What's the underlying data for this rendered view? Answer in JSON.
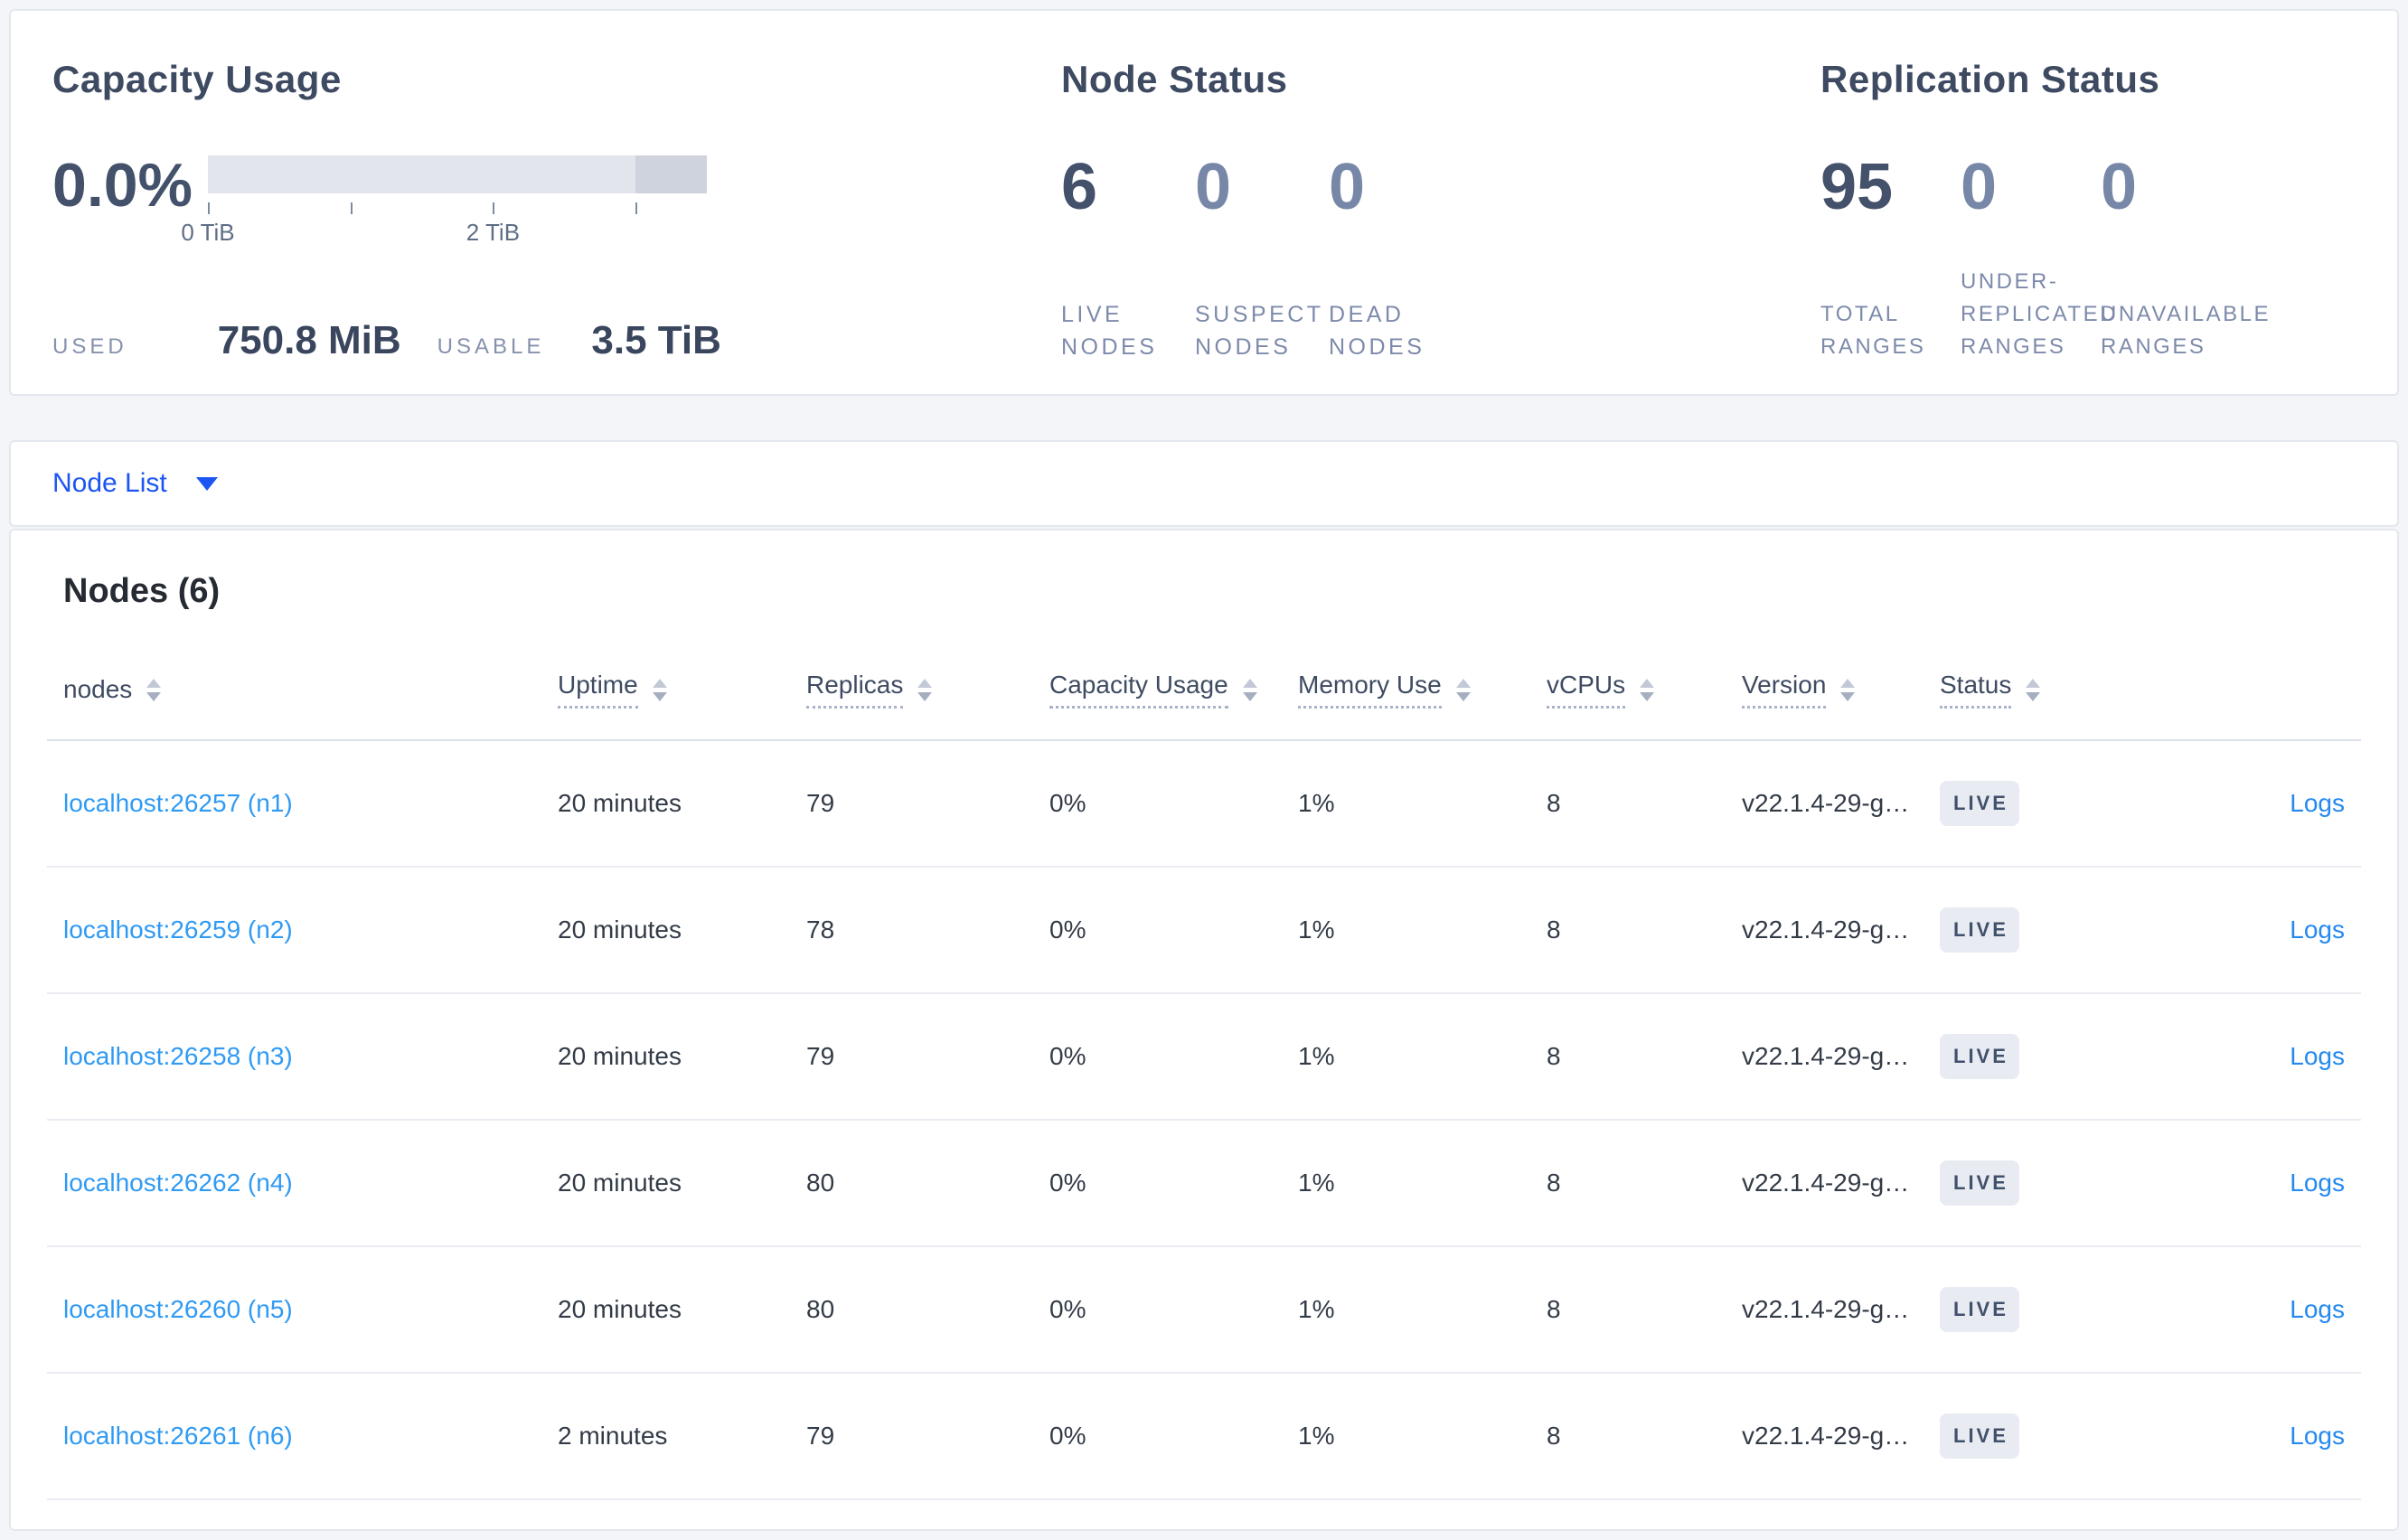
{
  "colors": {
    "accent_blue": "#1c55f2",
    "node_link_blue": "#2f9af3",
    "logs_link_blue": "#2489f0",
    "live_badge_bg": "#e8ebf2",
    "live_badge_text": "#41506b",
    "bar_light": "#e2e5eb",
    "bar_dark": "#ced3dd",
    "stat_primary": "#44516a",
    "stat_muted": "#7787a8"
  },
  "icons": {
    "chevron_down": "triangle-down",
    "sort": "double-triangle-up-down"
  },
  "summary": {
    "capacity": {
      "title": "Capacity Usage",
      "percent": "0.0%",
      "used_label": "USED",
      "used_value": "750.8 MiB",
      "usable_label": "USABLE",
      "usable_value": "3.5 TiB",
      "axis": {
        "max_tib": 3.5,
        "dark_from_percent": 85.7,
        "ticks": [
          {
            "pos": 0,
            "label": "0 TiB"
          },
          {
            "pos": 28.57,
            "label": ""
          },
          {
            "pos": 57.14,
            "label": "2 TiB"
          },
          {
            "pos": 85.71,
            "label": ""
          }
        ]
      }
    },
    "node_status": {
      "title": "Node Status",
      "stats": [
        {
          "value": "6",
          "label": "LIVE NODES",
          "muted": false
        },
        {
          "value": "0",
          "label": "SUSPECT NODES",
          "muted": true
        },
        {
          "value": "0",
          "label": "DEAD NODES",
          "muted": true
        }
      ]
    },
    "replication": {
      "title": "Replication Status",
      "stats": [
        {
          "value": "95",
          "label": "TOTAL RANGES",
          "muted": false
        },
        {
          "value": "0",
          "label": "UNDER-REPLICATED RANGES",
          "muted": true
        },
        {
          "value": "0",
          "label": "UNAVAILABLE RANGES",
          "muted": true
        }
      ]
    }
  },
  "view_selector": {
    "label": "Node List"
  },
  "table": {
    "title": "Nodes (6)",
    "columns": [
      {
        "label": "nodes",
        "sortable": true,
        "underline": false
      },
      {
        "label": "Uptime",
        "sortable": true,
        "underline": true
      },
      {
        "label": "Replicas",
        "sortable": true,
        "underline": true
      },
      {
        "label": "Capacity Usage",
        "sortable": true,
        "underline": true
      },
      {
        "label": "Memory Use",
        "sortable": true,
        "underline": true
      },
      {
        "label": "vCPUs",
        "sortable": true,
        "underline": true
      },
      {
        "label": "Version",
        "sortable": true,
        "underline": true
      },
      {
        "label": "Status",
        "sortable": true,
        "underline": true
      },
      {
        "label": "",
        "sortable": false,
        "underline": false
      }
    ],
    "rows": [
      {
        "node": "localhost:26257 (n1)",
        "uptime": "20 minutes",
        "replicas": "79",
        "capacity": "0%",
        "memory": "1%",
        "vcpus": "8",
        "version": "v22.1.4-29-g…",
        "status": "LIVE",
        "logs": "Logs"
      },
      {
        "node": "localhost:26259 (n2)",
        "uptime": "20 minutes",
        "replicas": "78",
        "capacity": "0%",
        "memory": "1%",
        "vcpus": "8",
        "version": "v22.1.4-29-g…",
        "status": "LIVE",
        "logs": "Logs"
      },
      {
        "node": "localhost:26258 (n3)",
        "uptime": "20 minutes",
        "replicas": "79",
        "capacity": "0%",
        "memory": "1%",
        "vcpus": "8",
        "version": "v22.1.4-29-g…",
        "status": "LIVE",
        "logs": "Logs"
      },
      {
        "node": "localhost:26262 (n4)",
        "uptime": "20 minutes",
        "replicas": "80",
        "capacity": "0%",
        "memory": "1%",
        "vcpus": "8",
        "version": "v22.1.4-29-g…",
        "status": "LIVE",
        "logs": "Logs"
      },
      {
        "node": "localhost:26260 (n5)",
        "uptime": "20 minutes",
        "replicas": "80",
        "capacity": "0%",
        "memory": "1%",
        "vcpus": "8",
        "version": "v22.1.4-29-g…",
        "status": "LIVE",
        "logs": "Logs"
      },
      {
        "node": "localhost:26261 (n6)",
        "uptime": "2 minutes",
        "replicas": "79",
        "capacity": "0%",
        "memory": "1%",
        "vcpus": "8",
        "version": "v22.1.4-29-g…",
        "status": "LIVE",
        "logs": "Logs"
      }
    ]
  }
}
